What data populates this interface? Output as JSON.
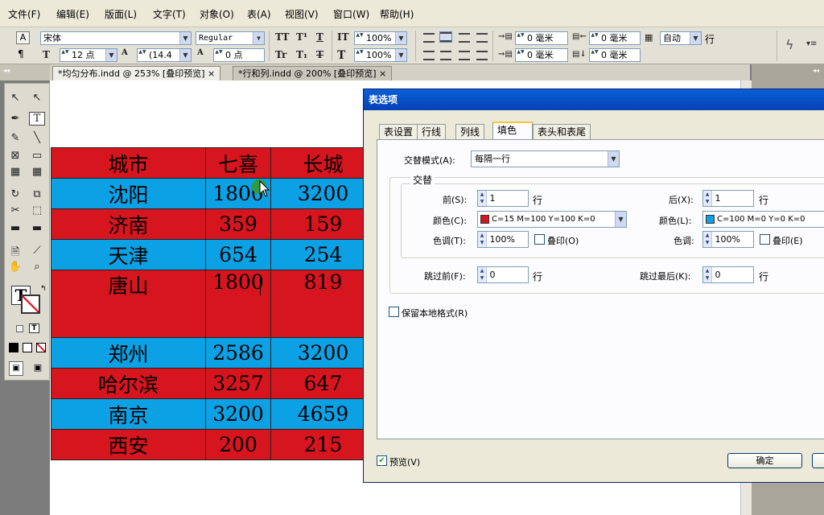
{
  "menu": [
    "文件(F)",
    "编辑(E)",
    "版面(L)",
    "文字(T)",
    "对象(O)",
    "表(A)",
    "视图(V)",
    "窗口(W)",
    "帮助(H)"
  ],
  "control": {
    "font_family": "宋体",
    "font_style": "Regular",
    "font_size": "12 点",
    "leading": "(14.4",
    "tracking": "0 点",
    "hscale": "100%",
    "vscale": "100%",
    "left_indent": "0 毫米",
    "right_indent": "0 毫米",
    "space_before": "0 毫米",
    "space_after": "0 毫米",
    "auto": "自动",
    "row_label": "行"
  },
  "tabs": [
    {
      "label": "*均匀分布.indd @ 253% [叠印预览]",
      "close": "×"
    },
    {
      "label": "*行和列.indd @ 200% [叠印预览]",
      "close": "×"
    }
  ],
  "table": {
    "rows": [
      [
        "城市",
        "七喜",
        "长城"
      ],
      [
        "沈阳",
        "1800",
        "3200"
      ],
      [
        "济南",
        "359",
        "159"
      ],
      [
        "天津",
        "654",
        "254"
      ],
      [
        "唐山",
        "1800",
        "819"
      ],
      [
        "郑州",
        "2586",
        "3200"
      ],
      [
        "哈尔滨",
        "3257",
        "647"
      ],
      [
        "南京",
        "3200",
        "4659"
      ],
      [
        "西安",
        "200",
        "215"
      ]
    ]
  },
  "dialog": {
    "title": "表选项",
    "tabs": [
      "表设置",
      "行线",
      "列线",
      "填色",
      "表头和表尾"
    ],
    "alt_mode_label": "交替模式(A):",
    "alt_mode_value": "每隔一行",
    "alternate_group": "交替",
    "first_label": "前(S):",
    "first_value": "1",
    "next_label": "后(X):",
    "next_value": "1",
    "row_unit": "行",
    "color_label_1": "颜色(C):",
    "color_value_1": "C=15 M=100 Y=100 K=0",
    "color_label_2": "颜色(L):",
    "color_value_2": "C=100 M=0 Y=0 K=0",
    "tint_label_1": "色调(T):",
    "tint_value_1": "100%",
    "tint_label_2": "色调:",
    "tint_value_2": "100%",
    "overprint_1": "叠印(O)",
    "overprint_2": "叠印(E)",
    "skip_first_label": "跳过前(F):",
    "skip_first_value": "0",
    "skip_last_label": "跳过最后(K):",
    "skip_last_value": "0",
    "preserve_local": "保留本地格式(R)",
    "preview": "预览(V)",
    "ok": "确定",
    "swatch_1": "#d6151f",
    "swatch_2": "#0ca1e4"
  }
}
